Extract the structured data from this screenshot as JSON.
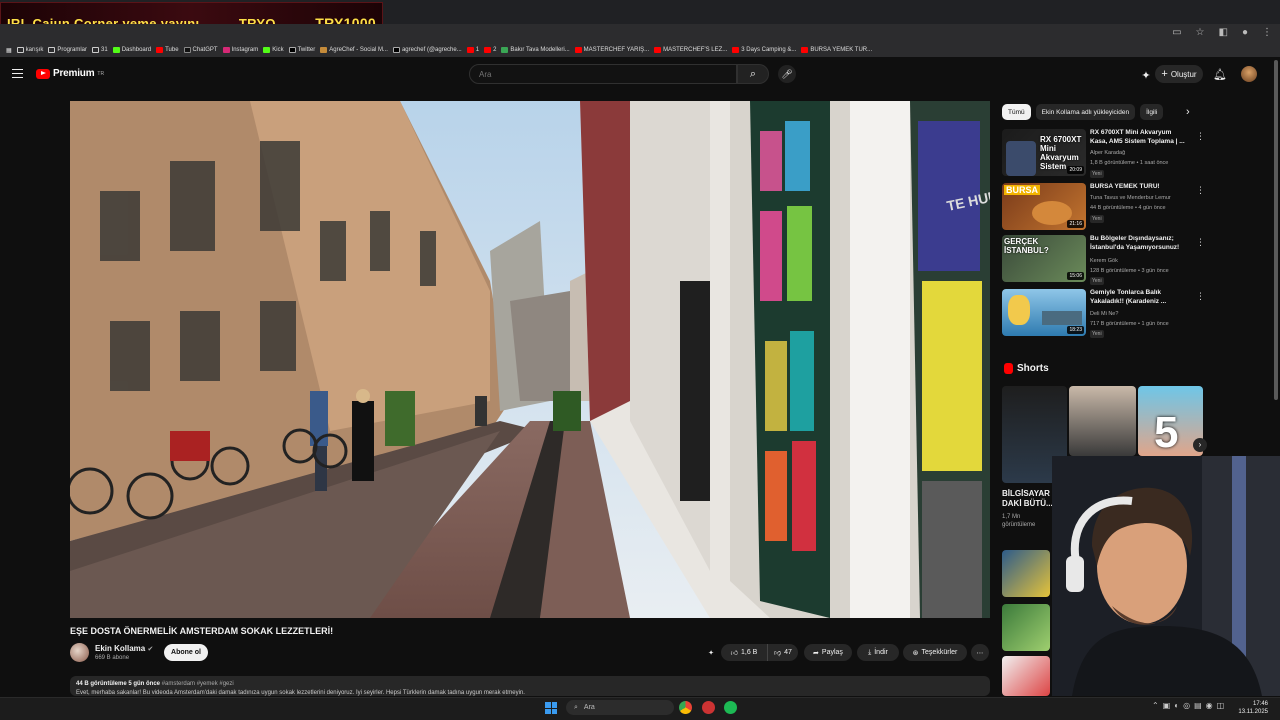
{
  "stream_overlay": {
    "title": "IRL Cajun Corner yeme yayını",
    "price_left": "TRYO",
    "price_right": "TRY1000"
  },
  "bookmarks": [
    "karışık",
    "Programlar",
    "31",
    "Dashboard",
    "Tube",
    "ChatGPT",
    "Instagram",
    "Kick",
    "Twitter",
    "AgreChef - Social M...",
    "agrechef (@agreche...",
    "1",
    "2",
    "Bakır Tava Modelleri...",
    "MASTERCHEF YARIŞ...",
    "MASTERCHEF'S LEZ...",
    "3 Days Camping &...",
    "BURSA YEMEK TUR..."
  ],
  "header": {
    "brand": "Premium",
    "brand_sup": "TR",
    "search_placeholder": "Ara",
    "create_label": "Oluştur"
  },
  "video": {
    "title": "EŞE DOSTA ÖNERMELİK AMSTERDAM SOKAK LEZZETLERİ!",
    "channel": "Ekin Kollama",
    "subscribers": "669 B abone",
    "subscribe_label": "Abone ol",
    "likes": "1,6 B",
    "dislikes": "47",
    "share_label": "Paylaş",
    "download_label": "İndir",
    "thanks_label": "Teşekkürler",
    "sign_text": "TE HUUR",
    "views_line": "44 B görüntüleme  5 gün önce",
    "tags": "#amsterdam #yemek #gezi",
    "desc_line": "Evet, merhaba sakanlar! Bu videoda Amsterdam'daki damak tadınıza uygun sokak lezzetlerini deniyoruz. İyi seyirler. Hepsi Türklerin damak tadına uygun merak etmeyin."
  },
  "chips": [
    "Tümü",
    "Ekin Kollama adlı yükleyiciden",
    "İlgili"
  ],
  "recommendations": [
    {
      "title": "RX 6700XT Mini Akvaryum Kasa, AM5 Sistem Toplama | ...",
      "channel": "Alper Karadağ",
      "views": "1,8 B görüntüleme • 1 saat önce",
      "badge": "Yeni",
      "duration": "20:09",
      "thumb_text": "RX 6700XT Mini Akvaryum Sistem"
    },
    {
      "title": "BURSA YEMEK TURU!",
      "channel": "Tuna Tavus ve Menderbur Lemur",
      "views": "44 B görüntüleme • 4 gün önce",
      "badge": "Yeni",
      "duration": "21:16",
      "thumb_text": "BURSA"
    },
    {
      "title": "Bu Bölgeler Dışındaysanız; İstanbul'da Yaşamıyorsunuz!",
      "channel": "Kerem Gök",
      "views": "128 B görüntüleme • 3 gün önce",
      "badge": "Yeni",
      "duration": "15:06",
      "thumb_text": "GERÇEK İSTANBUL?"
    },
    {
      "title": "Gemiyle Tonlarca Balık Yakaladık!! (Karadeniz ...",
      "channel": "Deli Mi Ne?",
      "views": "717 B görüntüleme • 1 gün önce",
      "badge": "Yeni",
      "duration": "18:23",
      "thumb_text": ""
    }
  ],
  "shorts": {
    "label": "Shorts",
    "title": "BİLGİSAYAR DAKİ BÜTÜ...",
    "views": "1,7 Mn görüntüleme",
    "big_number": "5"
  },
  "taskbar": {
    "search_placeholder": "Ara",
    "time": "17:46",
    "date": "13.11.2025"
  }
}
